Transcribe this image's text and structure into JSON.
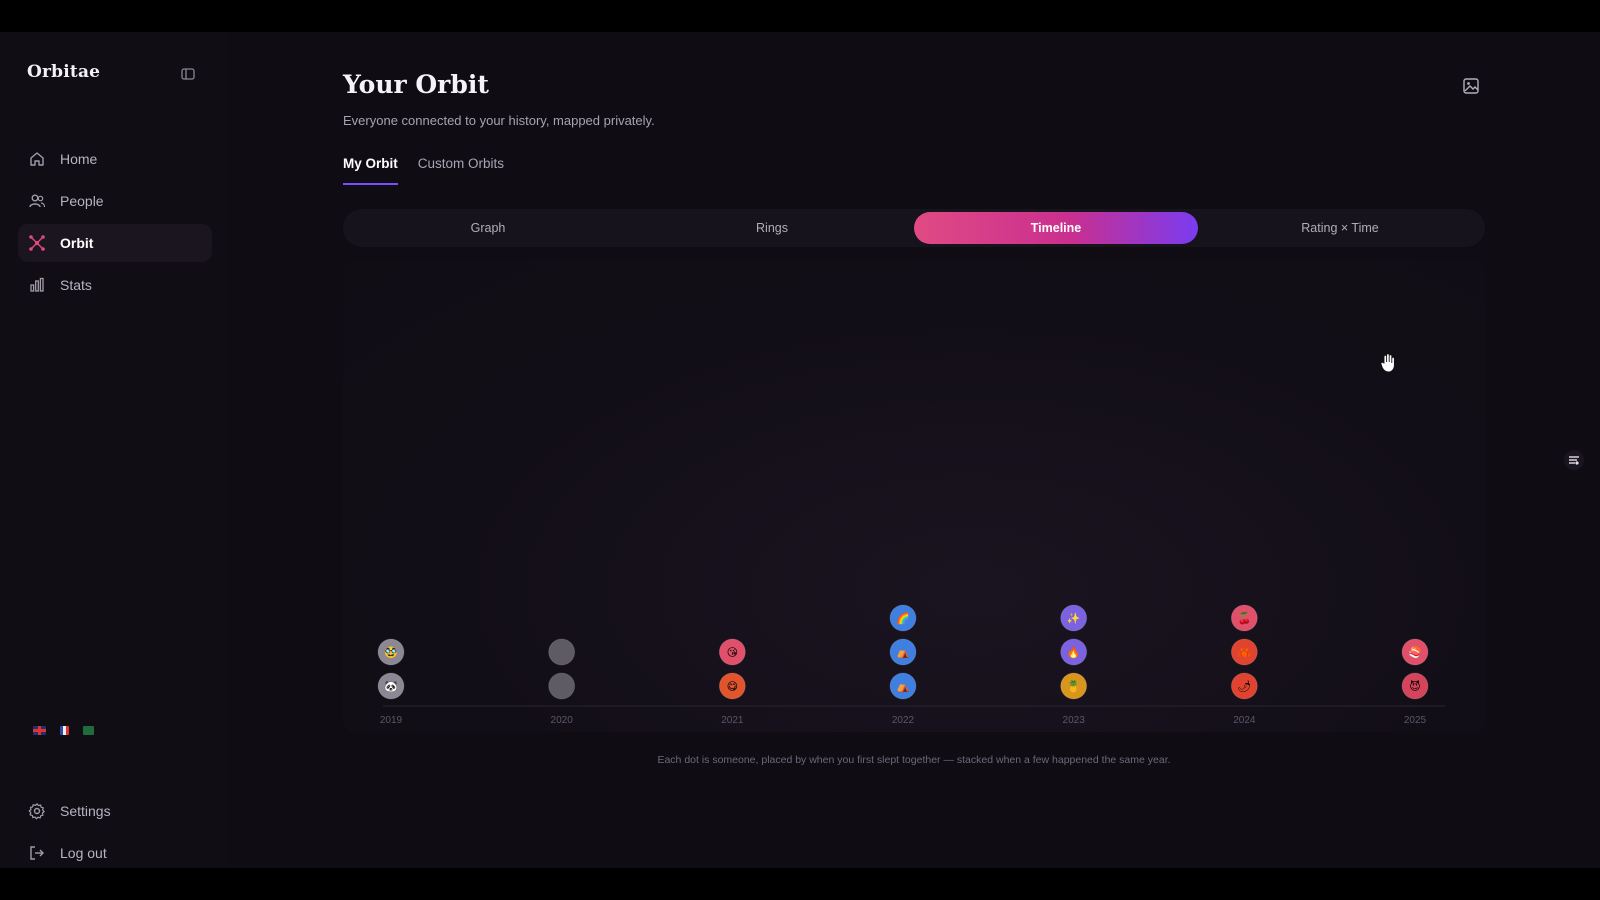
{
  "sidebar": {
    "brand": "Orbitae",
    "items": [
      {
        "label": "Home",
        "icon": "home-icon",
        "active": false
      },
      {
        "label": "People",
        "icon": "people-icon",
        "active": false
      },
      {
        "label": "Orbit",
        "icon": "orbit-icon",
        "active": true
      },
      {
        "label": "Stats",
        "icon": "stats-icon",
        "active": false
      }
    ],
    "languages": [
      "uk-flag-icon",
      "fr-flag-icon",
      "ar-flag-icon"
    ],
    "settings_label": "Settings",
    "logout_label": "Log out"
  },
  "header": {
    "title": "Your Orbit",
    "subtitle": "Everyone connected to your history, mapped privately."
  },
  "tabs": [
    {
      "label": "My Orbit",
      "active": true
    },
    {
      "label": "Custom Orbits",
      "active": false
    }
  ],
  "views": [
    {
      "label": "Graph",
      "active": false
    },
    {
      "label": "Rings",
      "active": false
    },
    {
      "label": "Timeline",
      "active": true
    },
    {
      "label": "Rating × Time",
      "active": false
    }
  ],
  "colors": {
    "accent_start": "#e14a84",
    "accent_end": "#7a3cf0",
    "orbit_icon": "#e24a7a"
  },
  "chart_data": {
    "type": "scatter",
    "title": "",
    "xlabel": "",
    "ylabel": "",
    "categories": [
      "2019",
      "2020",
      "2021",
      "2022",
      "2023",
      "2024",
      "2025"
    ],
    "stack_counts": [
      2,
      2,
      2,
      3,
      3,
      3,
      2
    ],
    "dots": [
      {
        "year": "2019",
        "stack": 1,
        "color": "#8c8794",
        "emoji": "🐼"
      },
      {
        "year": "2019",
        "stack": 2,
        "color": "#8c8794",
        "emoji": "🥸"
      },
      {
        "year": "2020",
        "stack": 1,
        "color": "#5e5a66",
        "emoji": ""
      },
      {
        "year": "2020",
        "stack": 2,
        "color": "#5e5a66",
        "emoji": ""
      },
      {
        "year": "2021",
        "stack": 1,
        "color": "#e0552e",
        "emoji": "😋"
      },
      {
        "year": "2021",
        "stack": 2,
        "color": "#e0506a",
        "emoji": "😘"
      },
      {
        "year": "2022",
        "stack": 1,
        "color": "#3f7fe0",
        "emoji": "⛺"
      },
      {
        "year": "2022",
        "stack": 2,
        "color": "#3f7fe0",
        "emoji": "⛺"
      },
      {
        "year": "2022",
        "stack": 3,
        "color": "#3f7fe0",
        "emoji": "🌈"
      },
      {
        "year": "2023",
        "stack": 1,
        "color": "#d9961e",
        "emoji": "🍍"
      },
      {
        "year": "2023",
        "stack": 2,
        "color": "#7a62e0",
        "emoji": "🔥"
      },
      {
        "year": "2023",
        "stack": 3,
        "color": "#7a62e0",
        "emoji": "✨"
      },
      {
        "year": "2024",
        "stack": 1,
        "color": "#e04430",
        "emoji": "🌶"
      },
      {
        "year": "2024",
        "stack": 2,
        "color": "#e04430",
        "emoji": "🦀"
      },
      {
        "year": "2024",
        "stack": 3,
        "color": "#e0506a",
        "emoji": "🍒"
      },
      {
        "year": "2025",
        "stack": 1,
        "color": "#d6445c",
        "emoji": "😈"
      },
      {
        "year": "2025",
        "stack": 2,
        "color": "#e0506a",
        "emoji": "🍣"
      }
    ],
    "grid": false,
    "caption": "Each dot is someone, placed by when you first slept together — stacked when a few happened the same year."
  }
}
